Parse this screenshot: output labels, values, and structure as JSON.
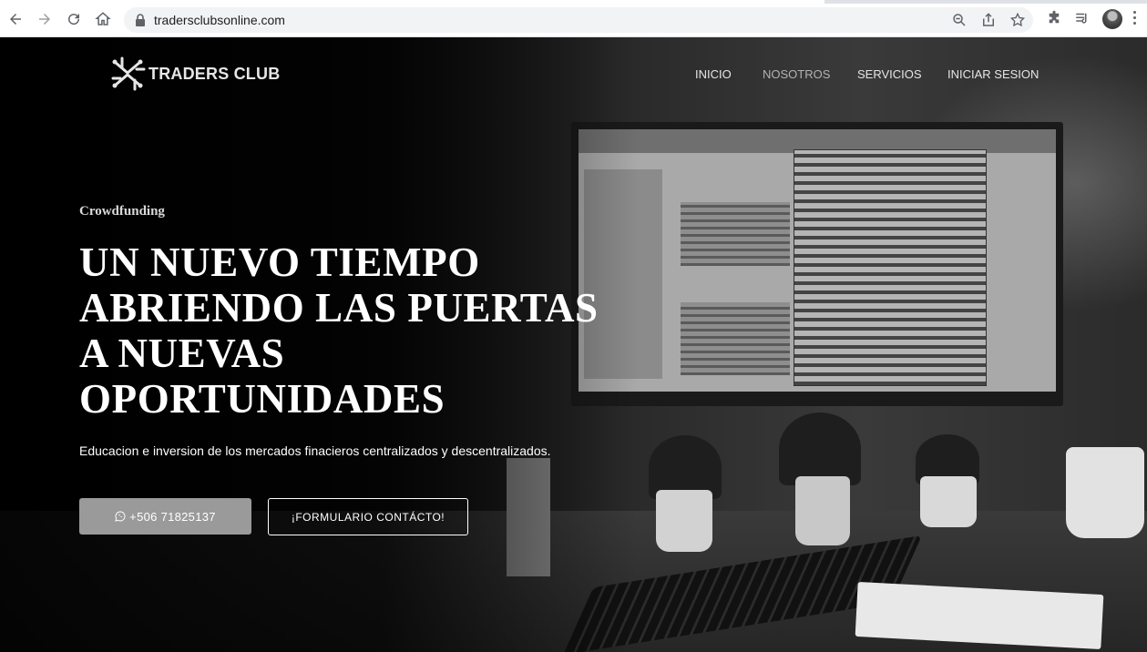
{
  "browser": {
    "url": "tradersclubsonline.com",
    "icons": [
      "back-icon",
      "forward-icon",
      "reload-icon",
      "home-icon",
      "lock-icon",
      "zoom-icon",
      "share-icon",
      "star-icon",
      "extensions-icon",
      "media-icon",
      "profile-avatar",
      "menu-icon"
    ]
  },
  "site": {
    "logo_text": "TRADERS CLUB",
    "nav": {
      "inicio": "INICIO",
      "nosotros": "NOSOTROS",
      "servicios": "SERVICIOS",
      "iniciar_sesion": "INICIAR SESION"
    },
    "hero": {
      "kicker": "Crowdfunding",
      "headline_lines": [
        "UN NUEVO TIEMPO",
        "ABRIENDO LAS PUERTAS",
        "A NUEVAS",
        "OPORTUNIDADES"
      ],
      "subtitle": "Educacion e inversion de los mercados finacieros centralizados y descentralizados.",
      "phone_button": "+506 71825137",
      "form_button": "¡FORMULARIO CONTÁCTO!"
    }
  },
  "colors": {
    "phone_button_bg": "#9a9a9a",
    "background": "#000000",
    "text": "#ffffff"
  }
}
